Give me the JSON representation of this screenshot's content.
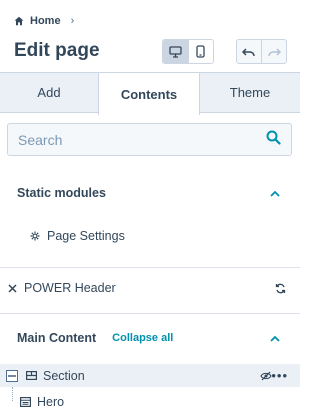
{
  "header": {
    "breadcrumb": {
      "home_label": "Home",
      "separator": "›"
    },
    "title": "Edit page",
    "view_toggle": {
      "active": "desktop"
    }
  },
  "tabs": [
    {
      "label": "Add"
    },
    {
      "label": "Contents",
      "active": true
    },
    {
      "label": "Theme"
    }
  ],
  "search": {
    "placeholder": "Search",
    "value": ""
  },
  "static_modules": {
    "title": "Static modules",
    "items": [
      {
        "label": "Page Settings",
        "icon": "gear-icon"
      }
    ]
  },
  "power_header": {
    "label": "POWER Header"
  },
  "main_content": {
    "title": "Main Content",
    "collapse_label": "Collapse all",
    "section": {
      "label": "Section",
      "hidden": true
    },
    "children": [
      {
        "label": "Hero"
      }
    ]
  },
  "colors": {
    "text": "#33475b",
    "link": "#0091ae",
    "tab_bg": "#eaf0f6",
    "border": "#cbd6e2",
    "selected_row": "#eaf0f6"
  }
}
